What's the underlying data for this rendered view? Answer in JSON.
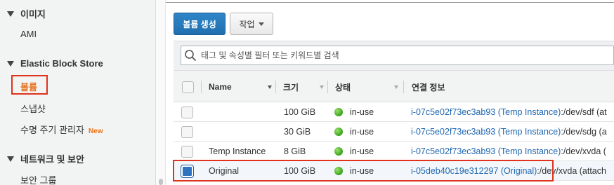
{
  "sidebar": {
    "images_section": "이미지",
    "ami": "AMI",
    "ebs_section": "Elastic Block Store",
    "volumes": "볼륨",
    "snapshots": "스냅샷",
    "lifecycle": "수명 주기 관리자",
    "new_badge": "New",
    "network_section": "네트워크 및 보안",
    "security_groups": "보안 그룹"
  },
  "toolbar": {
    "create_volume": "볼륨 생성",
    "actions": "작업"
  },
  "search": {
    "placeholder": "태그 및 속성별 필터 또는 키워드별 검색"
  },
  "table": {
    "headers": {
      "name": "Name",
      "size": "크기",
      "state": "상태",
      "attachment": "연결 정보"
    },
    "rows": [
      {
        "name": "",
        "size": "100 GiB",
        "state": "in-use",
        "instance": "i-07c5e02f73ec3ab93 (Temp Instance)",
        "device": ":/dev/sdf (at"
      },
      {
        "name": "",
        "size": "30 GiB",
        "state": "in-use",
        "instance": "i-07c5e02f73ec3ab93 (Temp Instance)",
        "device": ":/dev/sdg (a"
      },
      {
        "name": "Temp Instance",
        "size": "8 GiB",
        "state": "in-use",
        "instance": "i-07c5e02f73ec3ab93 (Temp Instance)",
        "device": ":/dev/xvda ("
      },
      {
        "name": "Original",
        "size": "100 GiB",
        "state": "in-use",
        "instance": "i-05deb40c19e312297 (Original)",
        "device": ":/dev/xvda (attach"
      }
    ]
  },
  "colors": {
    "accent": "#e4701e",
    "primary_button": "#1f6fb0",
    "link": "#1f66b0",
    "highlight": "#e0321c",
    "status_green": "#37a11a"
  }
}
